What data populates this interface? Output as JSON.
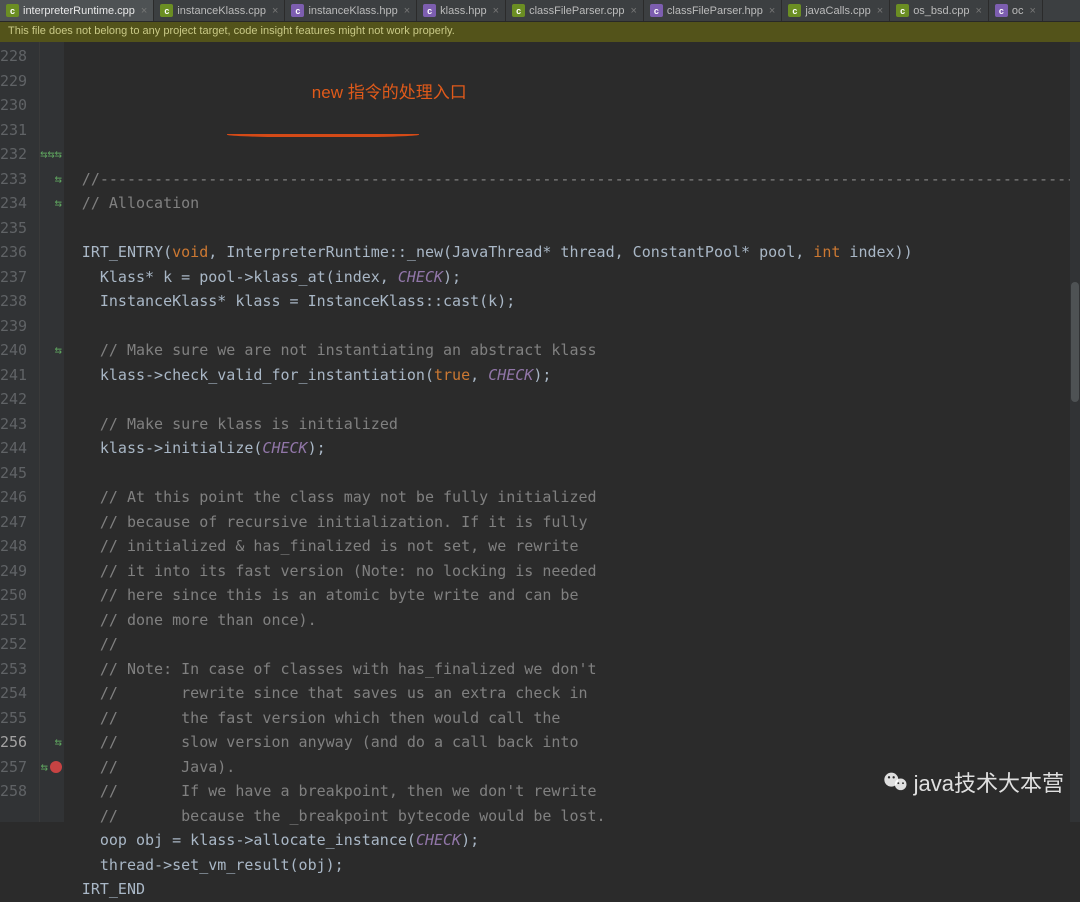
{
  "tabs": [
    {
      "label": "interpreterRuntime.cpp",
      "kind": "cpp",
      "active": true
    },
    {
      "label": "instanceKlass.cpp",
      "kind": "cpp",
      "active": false
    },
    {
      "label": "instanceKlass.hpp",
      "kind": "hpp",
      "active": false
    },
    {
      "label": "klass.hpp",
      "kind": "hpp",
      "active": false
    },
    {
      "label": "classFileParser.cpp",
      "kind": "cpp",
      "active": false
    },
    {
      "label": "classFileParser.hpp",
      "kind": "hpp",
      "active": false
    },
    {
      "label": "javaCalls.cpp",
      "kind": "cpp",
      "active": false
    },
    {
      "label": "os_bsd.cpp",
      "kind": "cpp",
      "active": false
    },
    {
      "label": "oc",
      "kind": "hpp",
      "active": false
    }
  ],
  "banner": "This file does not belong to any project target, code insight features might not work properly.",
  "annotation": "new 指令的处理入口",
  "watermark": "java技术大本营",
  "gutter_start": 228,
  "gutter_end": 258,
  "gutter_current": 256,
  "gutter_marks": {
    "232": [
      "swap",
      "swap",
      "swap"
    ],
    "233": [
      "swap"
    ],
    "234": [
      "swap"
    ],
    "240": [
      "swap"
    ],
    "256": [
      "swap"
    ],
    "257": [
      "swap",
      "breakpoint"
    ]
  },
  "code": [
    {
      "n": 228,
      "html": ""
    },
    {
      "n": 229,
      "html": "<span class='c-comment'>//------------------------------------------------------------------------------------------------------------------------</span>"
    },
    {
      "n": 230,
      "html": "<span class='c-comment'>// Allocation</span>"
    },
    {
      "n": 231,
      "html": ""
    },
    {
      "n": 232,
      "html": "IRT_ENTRY(<span class='c-kw'>void</span>, InterpreterRuntime::_new(JavaThread* thread, ConstantPool* pool, <span class='c-kw'>int</span> index))"
    },
    {
      "n": 233,
      "html": "  Klass* k = pool-&gt;klass_at(index, <span class='c-const'>CHECK</span>);"
    },
    {
      "n": 234,
      "html": "  InstanceKlass* klass = InstanceKlass::cast(k);"
    },
    {
      "n": 235,
      "html": ""
    },
    {
      "n": 236,
      "html": "  <span class='c-comment'>// Make sure we are not instantiating an abstract klass</span>"
    },
    {
      "n": 237,
      "html": "  klass-&gt;check_valid_for_instantiation(<span class='c-kw'>true</span>, <span class='c-const'>CHECK</span>);"
    },
    {
      "n": 238,
      "html": ""
    },
    {
      "n": 239,
      "html": "  <span class='c-comment'>// Make sure klass is initialized</span>"
    },
    {
      "n": 240,
      "html": "  klass-&gt;initialize(<span class='c-const'>CHECK</span>);"
    },
    {
      "n": 241,
      "html": ""
    },
    {
      "n": 242,
      "html": "  <span class='c-comment'>// At this point the class may not be fully initialized</span>"
    },
    {
      "n": 243,
      "html": "  <span class='c-comment'>// because of recursive initialization. If it is fully</span>"
    },
    {
      "n": 244,
      "html": "  <span class='c-comment'>// initialized &amp; has_finalized is not set, we rewrite</span>"
    },
    {
      "n": 245,
      "html": "  <span class='c-comment'>// it into its fast version (Note: no locking is needed</span>"
    },
    {
      "n": 246,
      "html": "  <span class='c-comment'>// here since this is an atomic byte write and can be</span>"
    },
    {
      "n": 247,
      "html": "  <span class='c-comment'>// done more than once).</span>"
    },
    {
      "n": 248,
      "html": "  <span class='c-comment'>//</span>"
    },
    {
      "n": 249,
      "html": "  <span class='c-comment'>// Note: In case of classes with has_finalized we don't</span>"
    },
    {
      "n": 250,
      "html": "  <span class='c-comment'>//       rewrite since that saves us an extra check in</span>"
    },
    {
      "n": 251,
      "html": "  <span class='c-comment'>//       the fast version which then would call the</span>"
    },
    {
      "n": 252,
      "html": "  <span class='c-comment'>//       slow version anyway (and do a call back into</span>"
    },
    {
      "n": 253,
      "html": "  <span class='c-comment'>//       Java).</span>"
    },
    {
      "n": 254,
      "html": "  <span class='c-comment'>//       If we have a breakpoint, then we don't rewrite</span>"
    },
    {
      "n": 255,
      "html": "  <span class='c-comment'>//       because the _breakpoint bytecode would be lost.</span>"
    },
    {
      "n": 256,
      "html": "  oop obj = klass-&gt;allocate_instance(<span class='c-const'>CHECK</span>);"
    },
    {
      "n": 257,
      "html": "  thread-&gt;set_vm_result(obj);"
    },
    {
      "n": 258,
      "html": "IRT_END"
    }
  ]
}
